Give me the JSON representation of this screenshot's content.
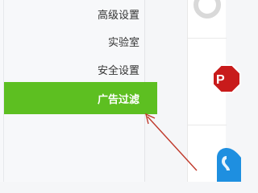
{
  "sidebar": {
    "items": [
      {
        "label": "高级设置",
        "active": false
      },
      {
        "label": "实验室",
        "active": false
      },
      {
        "label": "安全设置",
        "active": false
      },
      {
        "label": "广告过滤",
        "active": true
      }
    ]
  },
  "icons": {
    "top": "gray-circle-icon",
    "middle": "red-stop-icon",
    "bottom": "blue-shield-icon"
  },
  "colors": {
    "accent": "#5dbf21",
    "stop_red": "#c81b1b",
    "shield_blue": "#1e8fe0",
    "arrow_red": "#c0392b"
  }
}
